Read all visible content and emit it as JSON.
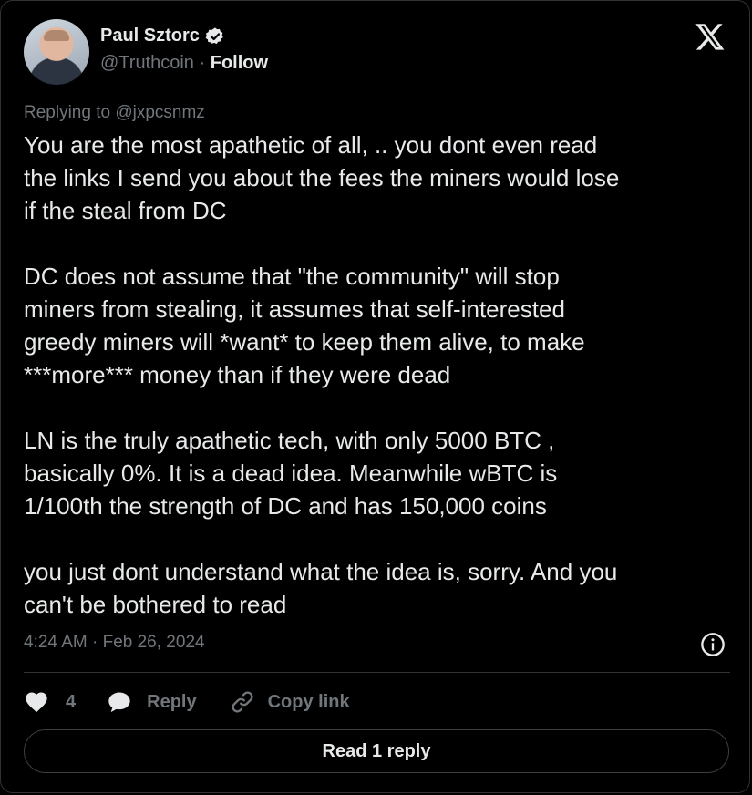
{
  "author": {
    "name": "Paul Sztorc",
    "handle": "@Truthcoin",
    "separator": "·",
    "follow_label": "Follow"
  },
  "tweet": {
    "replying_to": "Replying to @jxpcsnmz",
    "paragraphs": [
      "You are the most apathetic of all, .. you dont even read\nthe links I send you about the fees the miners would lose\nif the steal from DC",
      "DC does not assume that \"the community\" will stop\nminers from stealing, it assumes that self-interested\ngreedy miners will *want* to keep them alive, to make\n***more*** money than if they were dead",
      "LN is the truly apathetic tech, with only 5000 BTC ,\nbasically 0%. It is a dead idea. Meanwhile wBTC is\n1/100th the strength of DC and has 150,000 coins",
      "you just dont understand what the idea is, sorry. And you\ncan't be bothered to read"
    ],
    "timestamp": "4:24 AM · Feb 26, 2024"
  },
  "actions": {
    "like_count": "4",
    "reply_label": "Reply",
    "copy_label": "Copy link"
  },
  "read_replies_label": "Read 1 reply",
  "icons": {
    "verified": "verified-badge-icon",
    "close": "x-logo-icon",
    "info": "info-icon",
    "like": "heart-icon",
    "reply": "speech-bubble-icon",
    "copy": "link-icon"
  },
  "colors": {
    "background": "#000000",
    "text_primary": "#e7e9ea",
    "text_secondary": "#71767b",
    "border": "#2f3336"
  }
}
